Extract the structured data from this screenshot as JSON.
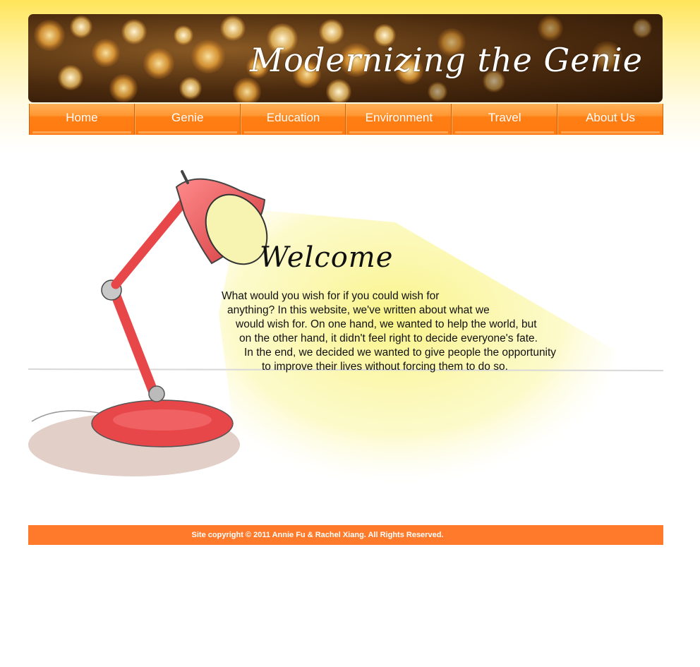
{
  "header": {
    "site_title": "Modernizing the Genie"
  },
  "nav": {
    "items": [
      {
        "label": "Home"
      },
      {
        "label": "Genie"
      },
      {
        "label": "Education"
      },
      {
        "label": "Environment"
      },
      {
        "label": "Travel"
      },
      {
        "label": "About Us"
      }
    ]
  },
  "main": {
    "welcome_title": "Welcome",
    "welcome_lines": [
      "What would you wish for if you could wish for",
      "anything? In this website, we've written about what we",
      "would wish for. On one hand, we wanted to help the world, but",
      "on the other hand, it didn't feel right to decide everyone's fate.",
      "In the end, we decided we wanted to give people the opportunity",
      "to improve their lives without forcing them to do so."
    ],
    "illustration_icon": "desk-lamp-icon"
  },
  "footer": {
    "copyright": "Site copyright © 2011 Annie Fu & Rachel Xiang. All Rights Reserved."
  },
  "colors": {
    "nav_orange": "#ff7a12",
    "footer_orange": "#ff7a2a",
    "lamp_red": "#e8474a",
    "light_yellow": "#fbf6a0"
  }
}
